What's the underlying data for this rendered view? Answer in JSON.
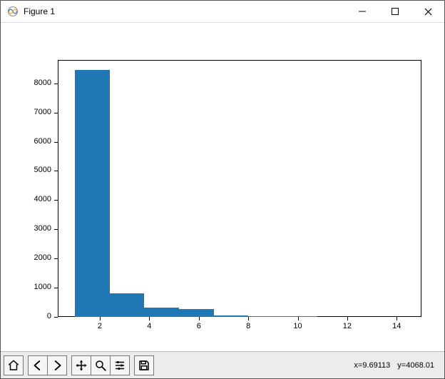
{
  "window": {
    "title": "Figure 1"
  },
  "toolbar": {
    "home": "Home",
    "back": "Back",
    "forward": "Forward",
    "pan": "Pan",
    "zoom": "Zoom",
    "configure": "Configure subplots",
    "save": "Save figure"
  },
  "status": {
    "coord_x_label": "x=",
    "coord_x_value": "9.69113",
    "coord_y_label": "y=",
    "coord_y_value": "4068.01"
  },
  "chart_data": {
    "type": "bar",
    "title": "",
    "xlabel": "",
    "ylabel": "",
    "xlim": [
      0.3,
      15.0
    ],
    "ylim": [
      0,
      8800
    ],
    "xticks": [
      2,
      4,
      6,
      8,
      10,
      12,
      14
    ],
    "yticks": [
      0,
      1000,
      2000,
      3000,
      4000,
      5000,
      6000,
      7000,
      8000
    ],
    "bin_edges": [
      1.0,
      2.4,
      3.8,
      5.2,
      6.6,
      8.0,
      9.4,
      10.8,
      12.2,
      13.6,
      15.0
    ],
    "values": [
      8450,
      800,
      330,
      280,
      60,
      20,
      20,
      0,
      0,
      0
    ]
  }
}
